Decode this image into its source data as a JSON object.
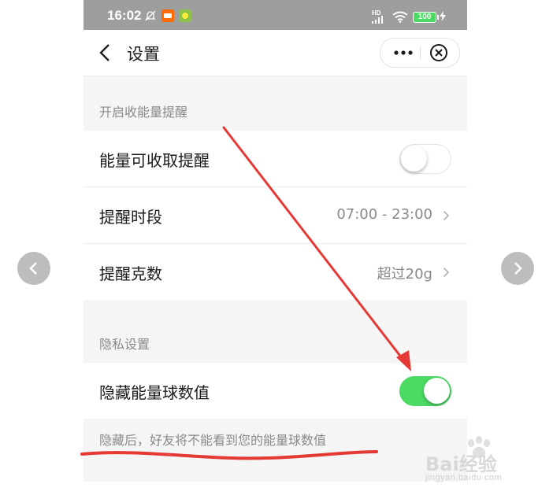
{
  "status_bar": {
    "time": "16:02",
    "network": "HD",
    "battery": "100"
  },
  "nav": {
    "title": "设置"
  },
  "sections": [
    {
      "header": "开启收能量提醒",
      "rows": [
        {
          "label": "能量可收取提醒",
          "toggle": "off"
        },
        {
          "label": "提醒时段",
          "value": "07:00 - 23:00"
        },
        {
          "label": "提醒克数",
          "value": "超过20g"
        }
      ]
    },
    {
      "header": "隐私设置",
      "rows": [
        {
          "label": "隐藏能量球数值",
          "toggle": "on"
        }
      ],
      "footnote": "隐藏后，好友将不能看到您的能量球数值"
    }
  ],
  "watermark": {
    "brand": "Bai经验",
    "url": "jingyan.baidu.com"
  },
  "colors": {
    "toggle_on": "#4cd964",
    "annotation": "#e53935",
    "status_bar": "#9e9e9e"
  }
}
